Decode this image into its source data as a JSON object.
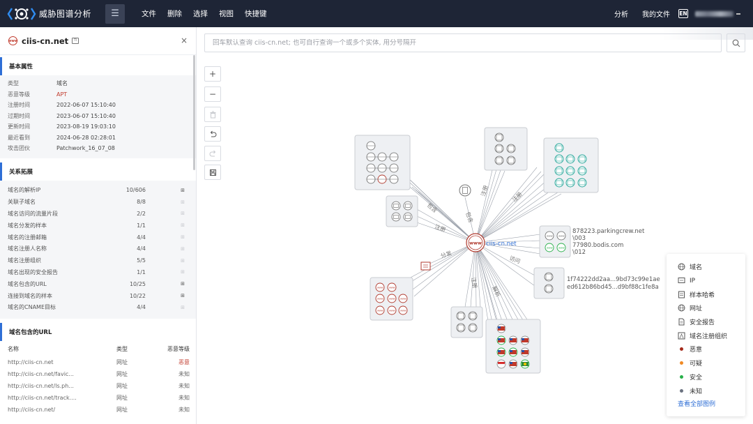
{
  "app": {
    "title": "威胁图谱分析"
  },
  "topnav": [
    "文件",
    "删除",
    "选择",
    "视图",
    "快捷键"
  ],
  "topright": {
    "analysis": "分析",
    "my_files": "我的文件",
    "lang": "EN"
  },
  "panel": {
    "title": "ciis-cn.net",
    "basic": {
      "title": "基本属性",
      "rows": [
        {
          "k": "类型",
          "v": "域名"
        },
        {
          "k": "恶意等级",
          "v": "APT"
        },
        {
          "k": "注册时间",
          "v": "2022-06-07 15:10:40"
        },
        {
          "k": "过期时间",
          "v": "2023-06-07 15:10:40"
        },
        {
          "k": "更新时间",
          "v": "2023-08-19 19:03:10"
        },
        {
          "k": "最近看到",
          "v": "2024-06-28 02:28:01"
        },
        {
          "k": "攻击团伙",
          "v": "Patchwork_16_07_08"
        }
      ]
    },
    "relations": {
      "title": "关系拓展",
      "rows": [
        {
          "name": "域名的解析IP",
          "count": "10/606"
        },
        {
          "name": "关联子域名",
          "count": "8/8"
        },
        {
          "name": "域名访问的流量片段",
          "count": "2/2"
        },
        {
          "name": "域名分发的样本",
          "count": "1/1"
        },
        {
          "name": "域名的注册邮箱",
          "count": "4/4"
        },
        {
          "name": "域名注册人名称",
          "count": "4/4"
        },
        {
          "name": "域名注册组织",
          "count": "5/5"
        },
        {
          "name": "域名出现的安全报告",
          "count": "1/1"
        },
        {
          "name": "域名包含的URL",
          "count": "10/25"
        },
        {
          "name": "连接到域名的样本",
          "count": "10/22"
        },
        {
          "name": "域名的CNAME目标",
          "count": "4/4"
        }
      ]
    },
    "urls": {
      "title": "域名包含的URL",
      "headers": {
        "name": "名称",
        "type": "类型",
        "level": "恶意等级"
      },
      "rows": [
        {
          "name": "http://ciis-cn.net",
          "type": "网址",
          "level": "恶意"
        },
        {
          "name": "http://ciis-cn.net/favic...",
          "type": "网址",
          "level": "未知"
        },
        {
          "name": "http://ciis-cn.net/ls.ph...",
          "type": "网址",
          "level": "未知"
        },
        {
          "name": "http://ciis-cn.net/track....",
          "type": "网址",
          "level": "未知"
        },
        {
          "name": "http://ciis-cn.net/",
          "type": "网址",
          "level": "未知"
        }
      ]
    }
  },
  "search": {
    "placeholder": "回车默认查询 ciis-cn.net; 也可自行查询一个或多个实体, 用分号隔开"
  },
  "graph": {
    "center_label": "ciis-cn.net",
    "edge_labels": [
      "包含",
      "包含",
      "注册",
      "注册",
      "注册",
      "分发",
      "访问",
      "注册",
      "解析"
    ],
    "domain_labels": [
      "878223.parkingcrew.net",
      "\\003",
      "77980.bodis.com",
      "\\012"
    ],
    "hash_labels": [
      "1f74222dd2aa...9bd73c99e1ae",
      "ed612b86bd45...d9bf88c1fe8a"
    ]
  },
  "legend": {
    "items": [
      {
        "label": "域名",
        "icon": "domain-icon"
      },
      {
        "label": "IP",
        "icon": "ip-icon"
      },
      {
        "label": "样本哈希",
        "icon": "sample-hash-icon"
      },
      {
        "label": "网址",
        "icon": "url-icon"
      },
      {
        "label": "安全报告",
        "icon": "report-icon"
      },
      {
        "label": "域名注册组织",
        "icon": "registrant-org-icon"
      }
    ],
    "levels": [
      {
        "label": "恶意",
        "color": "#a52a1a"
      },
      {
        "label": "可疑",
        "color": "#f08a24"
      },
      {
        "label": "安全",
        "color": "#28b04a"
      },
      {
        "label": "未知",
        "color": "#6b7280"
      }
    ],
    "link": "查看全部图例"
  }
}
